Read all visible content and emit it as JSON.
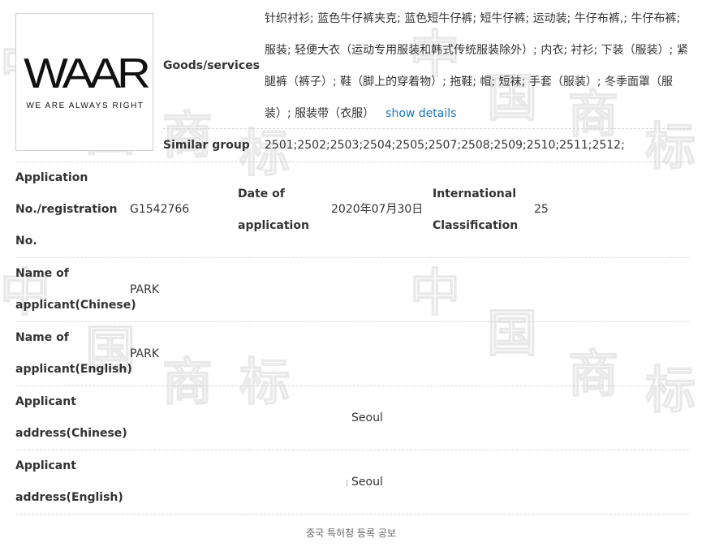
{
  "logo": {
    "wordmark": "WAAR",
    "tagline": "WE ARE ALWAYS RIGHT"
  },
  "goods": {
    "label": "Goods/services",
    "text": "针织衬衫; 蓝色牛仔裤夹克; 蓝色短牛仔裤; 短牛仔裤; 运动装; 牛仔布裤,; 牛仔布裤; 服装; 轻便大衣（运动专用服装和韩式传统服装除外）; 内衣; 衬衫; 下装（服装）; 紧腿裤（裤子）; 鞋（脚上的穿着物）; 拖鞋; 帽; 短袜; 手套（服装）; 冬季面罩（服装）; 服装带（衣服）",
    "show_details": "show details"
  },
  "similar_group": {
    "label": "Similar group",
    "value": "2501;2502;2503;2504;2505;2507;2508;2509;2510;2511;2512;"
  },
  "application": {
    "label_line1": "Application",
    "label_line2": "No./registration",
    "label_line3": "No.",
    "value": "G1542766"
  },
  "date_of_application": {
    "label_line1": "Date of",
    "label_line2": "application",
    "value": "2020年07月30日"
  },
  "classification": {
    "label_line1": "International",
    "label_line2": "Classification",
    "value": "25"
  },
  "applicant_cn": {
    "label_line1": "Name of",
    "label_line2": "applicant(Chinese)",
    "value": "PARK"
  },
  "applicant_en": {
    "label_line1": "Name of",
    "label_line2": "applicant(English)",
    "value": "PARK"
  },
  "address_cn": {
    "label_line1": "Applicant",
    "label_line2": "address(Chinese)",
    "value": "Seoul"
  },
  "address_en": {
    "label_line1": "Applicant",
    "label_line2": "address(English)",
    "value": "Seoul"
  },
  "footer": {
    "text": "중국 특허청 등록 공보"
  }
}
